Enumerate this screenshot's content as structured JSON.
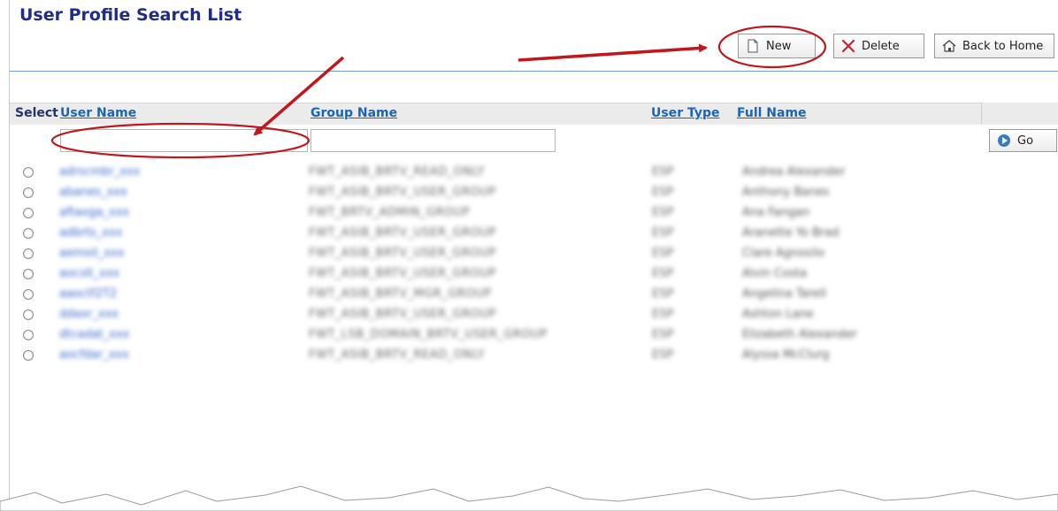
{
  "page": {
    "title": "User Profile Search List"
  },
  "toolbar": {
    "new_label": "New",
    "delete_label": "Delete",
    "home_label": "Back to Home"
  },
  "table": {
    "columns": {
      "select": "Select",
      "user_name": "User Name",
      "group_name": "Group Name",
      "user_type": "User Type",
      "full_name": "Full Name"
    },
    "go_label": "Go",
    "filters": {
      "user_name": "",
      "group_name": ""
    },
    "rows": [
      {
        "user": "adrscmbr_xxx",
        "group": "FWT_ASIB_BRTV_READ_ONLY",
        "type": "ESP",
        "full": "Andrea Alexander"
      },
      {
        "user": "abanes_xxx",
        "group": "FWT_ASIB_BRTV_USER_GROUP",
        "type": "ESP",
        "full": "Anthony Banes"
      },
      {
        "user": "aftaoga_xxx",
        "group": "FWT_BRTV_ADMIN_GROUP",
        "type": "ESP",
        "full": "Ana Fangan"
      },
      {
        "user": "adbrts_xxx",
        "group": "FWT_ASIB_BRTV_USER_GROUP",
        "type": "ESP",
        "full": "Aranette Yo Brad"
      },
      {
        "user": "aemoil_xxx",
        "group": "FWT_ASIB_BRTV_USER_GROUP",
        "type": "ESP",
        "full": "Clare Agnosilo"
      },
      {
        "user": "aocslt_xxx",
        "group": "FWT_ASIB_BRTV_USER_GROUP",
        "type": "ESP",
        "full": "Alvin Costa"
      },
      {
        "user": "aaoctf2T2",
        "group": "FWT_ASIB_BRTV_MGR_GROUP",
        "type": "ESP",
        "full": "Angelina Tarell"
      },
      {
        "user": "ddaxr_xxx",
        "group": "FWT_ASIB_BRTV_USER_GROUP",
        "type": "ESP",
        "full": "Ashton Lane"
      },
      {
        "user": "dtcadat_xxx",
        "group": "FWT_LSB_DOMAIN_BRTV_USER_GROUP",
        "type": "ESP",
        "full": "Elizabeth Alexander"
      },
      {
        "user": "aocfdar_xxx",
        "group": "FWT_ASIB_BRTV_READ_ONLY",
        "type": "ESP",
        "full": "Alyssa McClurg"
      }
    ]
  },
  "colors": {
    "annotation": "#c0171c",
    "title": "#1f2d8a",
    "link": "#1a64b5"
  }
}
